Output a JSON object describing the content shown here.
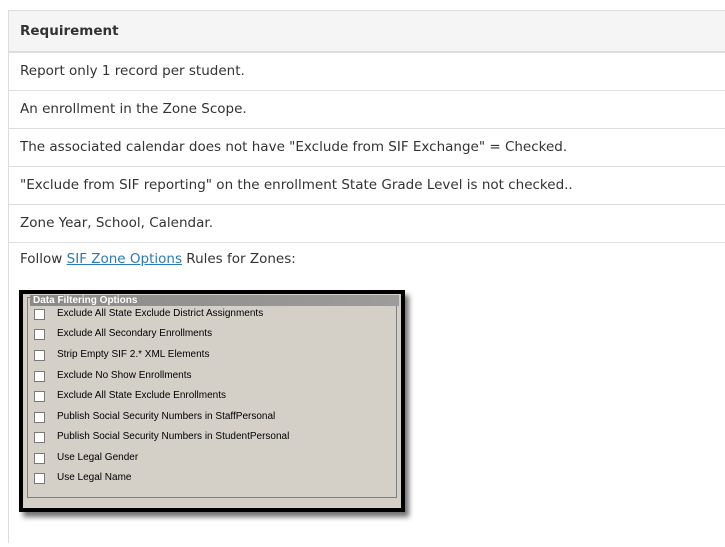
{
  "table": {
    "header": "Requirement",
    "rows": [
      "Report only 1 record per student.",
      "An enrollment in the Zone Scope.",
      "The associated calendar does not have \"Exclude from SIF Exchange\" = Checked.",
      "\"Exclude from SIF reporting\" on the enrollment State Grade Level is not checked..",
      "Zone Year, School, Calendar."
    ],
    "follow_prefix": "Follow ",
    "follow_link": "SIF Zone Options",
    "follow_suffix": " Rules for Zones:"
  },
  "panel": {
    "legend": "Data Filtering Options",
    "options": [
      {
        "label": "Exclude All State Exclude District Assignments",
        "checked": false
      },
      {
        "label": "Exclude All Secondary Enrollments",
        "checked": false
      },
      {
        "label": "Strip Empty SIF 2.* XML Elements",
        "checked": false
      },
      {
        "label": "Exclude No Show Enrollments",
        "checked": false
      },
      {
        "label": "Exclude All State Exclude Enrollments",
        "checked": false
      },
      {
        "label": "Publish Social Security Numbers in StaffPersonal",
        "checked": false
      },
      {
        "label": "Publish Social Security Numbers in StudentPersonal",
        "checked": false
      },
      {
        "label": "Use Legal Gender",
        "checked": false
      },
      {
        "label": "Use Legal Name",
        "checked": false
      }
    ]
  },
  "colors": {
    "link": "#2a7ab9",
    "border": "#dddddd",
    "header_bg": "#f5f5f5",
    "panel_bg": "#d4d0c8"
  }
}
